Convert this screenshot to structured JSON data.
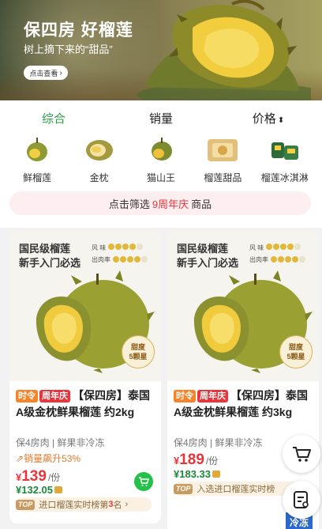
{
  "banner": {
    "title": "保四房 好榴莲",
    "subtitle": "树上摘下来的“甜品”",
    "button_label": "点击查看"
  },
  "tabs": [
    {
      "label": "综合",
      "active": true
    },
    {
      "label": "销量",
      "active": false
    },
    {
      "label": "价格",
      "active": false,
      "sort_icon": "sort-up-down-icon"
    }
  ],
  "categories": [
    {
      "label": "鲜榴莲",
      "icon": "whole-durian-icon"
    },
    {
      "label": "金枕",
      "icon": "golden-pillow-durian-icon"
    },
    {
      "label": "猫山王",
      "icon": "musang-king-durian-icon"
    },
    {
      "label": "榴莲甜品",
      "icon": "durian-dessert-icon"
    },
    {
      "label": "榴莲冰淇淋",
      "icon": "durian-ice-cream-icon"
    }
  ],
  "filter": {
    "prefix": "点击筛选",
    "highlight": "9周年庆",
    "suffix": "商品"
  },
  "products": [
    {
      "banner_line1": "国民级榴莲",
      "banner_line2": "新手入门必选",
      "meta_label1": "风  味",
      "meta_label2": "出肉率",
      "flavor_level": 4,
      "yield_level": 4,
      "sweetness_label": "甜度",
      "sweetness_value": "5颗星",
      "tag1": "时令",
      "tag2": "周年庆",
      "title": "【保四房】泰国A级金枕鲜果榴莲 约2kg",
      "spec": "保4房肉 | 鲜果非冷冻",
      "sales": "销量飙升53%",
      "currency": "¥",
      "price": "139",
      "unit": "/份",
      "member_price": "¥132.05",
      "rank_badge": "TOP",
      "rank_text": "进口榴莲实时榜第",
      "rank_num": "3",
      "rank_suffix": "名",
      "has_cart_button": true
    },
    {
      "banner_line1": "国民级榴莲",
      "banner_line2": "新手入门必选",
      "meta_label1": "风  味",
      "meta_label2": "出肉率",
      "flavor_level": 4,
      "yield_level": 4,
      "sweetness_label": "甜度",
      "sweetness_value": "5颗星",
      "tag1": "时令",
      "tag2": "周年庆",
      "title": "【保四房】泰国A级金枕鲜果榴莲 约3kg",
      "spec": "保4房肉 | 鲜果非冷冻",
      "currency": "¥",
      "price": "189",
      "unit": "/份",
      "member_price": "¥183.33",
      "rank_badge": "TOP",
      "rank_text": "入选进口榴莲实时榜"
    }
  ],
  "floating": {
    "cart_icon": "shopping-cart-icon",
    "order_icon": "order-list-icon"
  },
  "corner_badge": "冷冻",
  "colors": {
    "accent_green": "#2c9b48",
    "price_red": "#e8353b",
    "member_green": "#1a8a3a",
    "tag_orange": "#f5842a"
  }
}
